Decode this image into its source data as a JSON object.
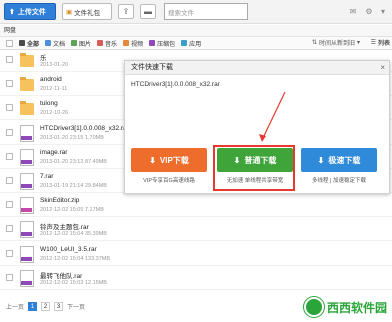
{
  "toolbar": {
    "upload_label": "上传文件",
    "newfolder_label": "文件礼包",
    "search_placeholder": "搜索文件"
  },
  "breadcrumb": "网盘",
  "filters": [
    {
      "label": "全部",
      "color": "#4a4a4a"
    },
    {
      "label": "文档",
      "color": "#4f8fd6"
    },
    {
      "label": "图片",
      "color": "#5aa55a"
    },
    {
      "label": "音乐",
      "color": "#d95d5d"
    },
    {
      "label": "视频",
      "color": "#e2893a"
    },
    {
      "label": "压缩包",
      "color": "#8e4bb8"
    },
    {
      "label": "应用",
      "color": "#3a9ec8"
    }
  ],
  "sort_label": "时间从新到旧",
  "view_label": "列表",
  "files": [
    {
      "name": "乐",
      "meta": "2013-01-20",
      "type": "folder"
    },
    {
      "name": "android",
      "meta": "2012-11-11",
      "type": "folder"
    },
    {
      "name": "tulong",
      "meta": "2012-10-26",
      "type": "folder"
    },
    {
      "name": "HTCDriver3[1].0.0.008_x32.rar",
      "meta": "2013-01-20 23:15   1.70MB",
      "type": "rar"
    },
    {
      "name": "image.rar",
      "meta": "2013-01-20 23:12   87.49MB",
      "type": "rar"
    },
    {
      "name": "7.rar",
      "meta": "2013-01-19 21:14   29.84MB",
      "type": "rar"
    },
    {
      "name": "SkinEditor.zip",
      "meta": "2012-12-02 15:05   7.17MB",
      "type": "zip"
    },
    {
      "name": "铃声及主题包.rar",
      "meta": "2012-12-02 15:04   35.39MB",
      "type": "rar"
    },
    {
      "name": "W100_LeUI_3.5.rar",
      "meta": "2012-12-02 15:04   133.37MB",
      "type": "rar"
    },
    {
      "name": "最转飞他队.rar",
      "meta": "2012-12-02 15:03   12.15MB",
      "type": "rar"
    }
  ],
  "pager": {
    "prev": "上一页",
    "pages": [
      "1",
      "2",
      "3"
    ],
    "next": "下一页"
  },
  "dialog": {
    "title": "文件快速下载",
    "filename": "HTCDriver3[1].0.0.008_x32.rar",
    "buttons": [
      {
        "label": "VIP下载",
        "note": "VIP专享百G高速线路"
      },
      {
        "label": "普通下载",
        "note": "无加速 单线程共享带宽"
      },
      {
        "label": "极速下载",
        "note": "多线程 | 加速稳定下载"
      }
    ]
  },
  "watermark": "西西软件园"
}
